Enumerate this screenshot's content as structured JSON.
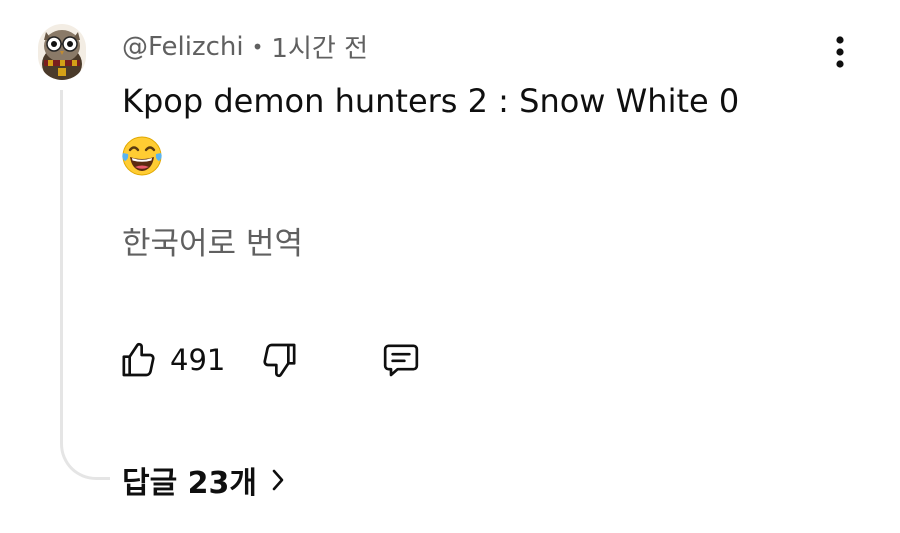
{
  "comment": {
    "author": "@Felizchi",
    "separator": "•",
    "time": "1시간 전",
    "text": "Kpop demon hunters 2 : Snow White 0",
    "translate_label": "한국어로 번역",
    "like_count": "491",
    "replies_label": "답글 23개"
  },
  "icons": {
    "avatar": "owl-avatar",
    "emoji": "face-with-tears-of-joy",
    "like": "thumbs-up-icon",
    "dislike": "thumbs-down-icon",
    "reply": "comment-icon",
    "more": "vertical-dots-icon",
    "chevron": "chevron-right-icon"
  },
  "colors": {
    "text_primary": "#0f0f0f",
    "text_secondary": "#606060",
    "thread_line": "#e5e5e5"
  }
}
